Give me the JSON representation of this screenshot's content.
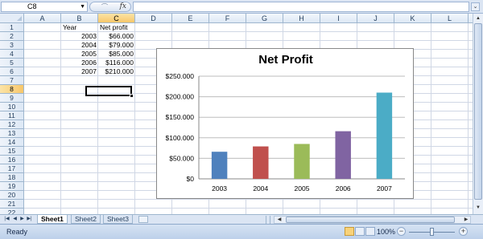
{
  "formula_bar": {
    "name_box": "C8",
    "fx_label": "fx",
    "formula": ""
  },
  "columns": [
    "A",
    "B",
    "C",
    "D",
    "E",
    "F",
    "G",
    "H",
    "I",
    "J",
    "K",
    "L",
    "M"
  ],
  "active_column": "C",
  "rows": [
    "1",
    "2",
    "3",
    "4",
    "5",
    "6",
    "7",
    "8",
    "9",
    "10",
    "11",
    "12",
    "13",
    "14",
    "15",
    "16",
    "17",
    "18",
    "19",
    "20",
    "21",
    "22"
  ],
  "active_row": "8",
  "cells": {
    "B1": "Year",
    "C1": "Net profit",
    "B2": "2003",
    "C2": "$66.000",
    "B3": "2004",
    "C3": "$79.000",
    "B4": "2005",
    "C4": "$85.000",
    "B5": "2006",
    "C5": "$116.000",
    "B6": "2007",
    "C6": "$210.000"
  },
  "chart_data": {
    "type": "bar",
    "title": "Net Profit",
    "categories": [
      "2003",
      "2004",
      "2005",
      "2006",
      "2007"
    ],
    "values": [
      66000,
      79000,
      85000,
      116000,
      210000
    ],
    "colors": [
      "#4f81bd",
      "#c0504d",
      "#9bbb59",
      "#8064a2",
      "#4bacc6"
    ],
    "ylim": [
      0,
      250000
    ],
    "yticks": [
      0,
      50000,
      100000,
      150000,
      200000,
      250000
    ],
    "ytick_labels": [
      "$0",
      "$50.000",
      "$100.000",
      "$150.000",
      "$200.000",
      "$250.000"
    ],
    "grid": true
  },
  "sheet_tabs": [
    "Sheet1",
    "Sheet2",
    "Sheet3"
  ],
  "active_sheet": "Sheet1",
  "status": {
    "ready": "Ready",
    "zoom": "100%",
    "zoom_minus": "−",
    "zoom_plus": "+"
  }
}
